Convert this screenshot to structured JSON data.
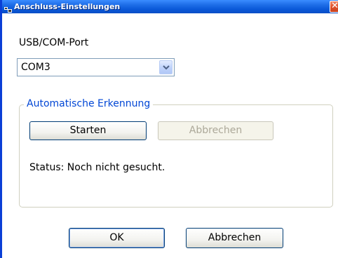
{
  "window": {
    "title": "Anschluss-Einstellungen",
    "close_glyph": "✕"
  },
  "port": {
    "label": "USB/COM-Port",
    "selected_value": "COM3"
  },
  "detection": {
    "group_title": "Automatische Erkennung",
    "start_label": "Starten",
    "cancel_label": "Abbrechen",
    "status_text": "Status: Noch nicht gesucht."
  },
  "footer": {
    "ok_label": "OK",
    "cancel_label": "Abbrechen"
  },
  "colors": {
    "titlebar": "#0a58d8",
    "group_title": "#0046d5",
    "close_button": "#e0542e"
  },
  "icons": {
    "app": "app-icon",
    "close": "close-icon",
    "dropdown": "chevron-down-icon"
  }
}
